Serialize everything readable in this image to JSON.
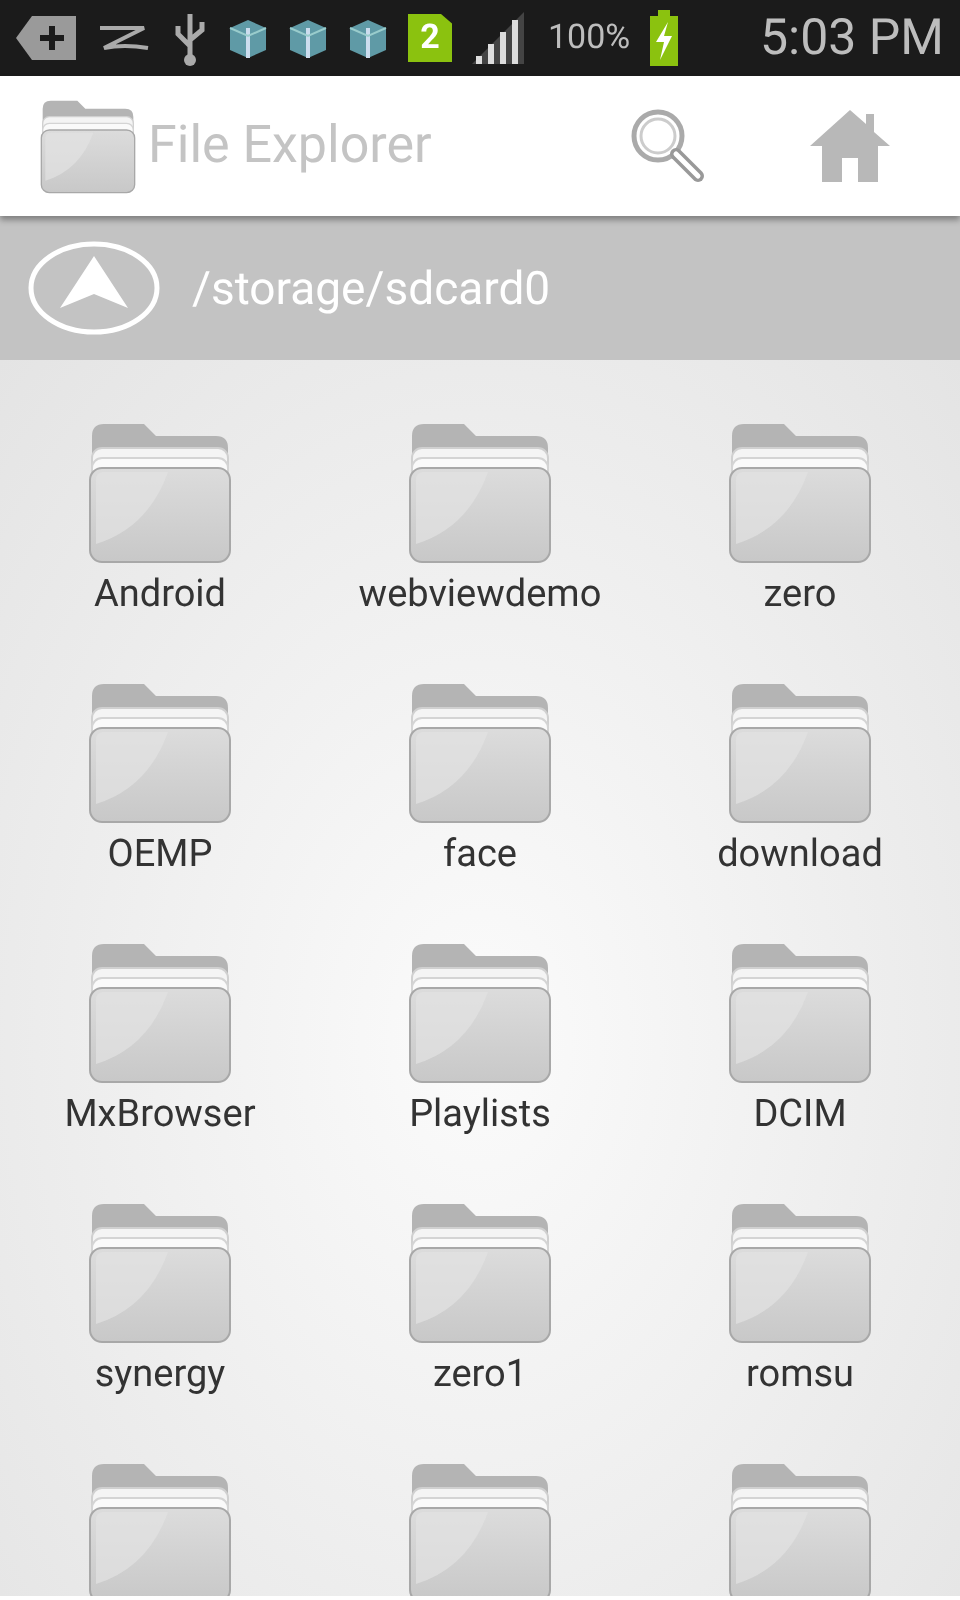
{
  "status_bar": {
    "sim_badge": "2",
    "battery": "100%",
    "time": "5:03 PM"
  },
  "app_bar": {
    "title": "File Explorer"
  },
  "path_bar": {
    "path": "/storage/sdcard0"
  },
  "folders": [
    {
      "kind": "folder",
      "name": "Android"
    },
    {
      "kind": "folder",
      "name": "webviewdemo"
    },
    {
      "kind": "folder",
      "name": "zero"
    },
    {
      "kind": "folder",
      "name": "OEMP"
    },
    {
      "kind": "folder",
      "name": "face"
    },
    {
      "kind": "folder",
      "name": "download"
    },
    {
      "kind": "folder",
      "name": "MxBrowser"
    },
    {
      "kind": "folder",
      "name": "Playlists"
    },
    {
      "kind": "folder",
      "name": "DCIM"
    },
    {
      "kind": "folder",
      "name": "synergy"
    },
    {
      "kind": "folder",
      "name": "zero1"
    },
    {
      "kind": "folder",
      "name": "romsu"
    },
    {
      "kind": "folder"
    },
    {
      "kind": "folder"
    },
    {
      "kind": "folder"
    }
  ]
}
